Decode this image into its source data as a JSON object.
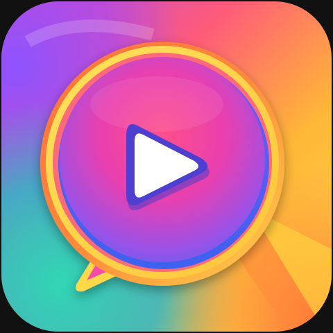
{
  "app_icon": {
    "icon_name": "video-chat-bubble-play-icon",
    "colors": {
      "background": "#111111",
      "pink": "#ff4f8b",
      "magenta": "#e83fb0",
      "purple": "#8a4fe0",
      "blue": "#3d62f0",
      "orange": "#ff7a2e",
      "yellow": "#ffd84a",
      "teal": "#2fc3b6",
      "play_triangle": "#ffffff"
    }
  }
}
